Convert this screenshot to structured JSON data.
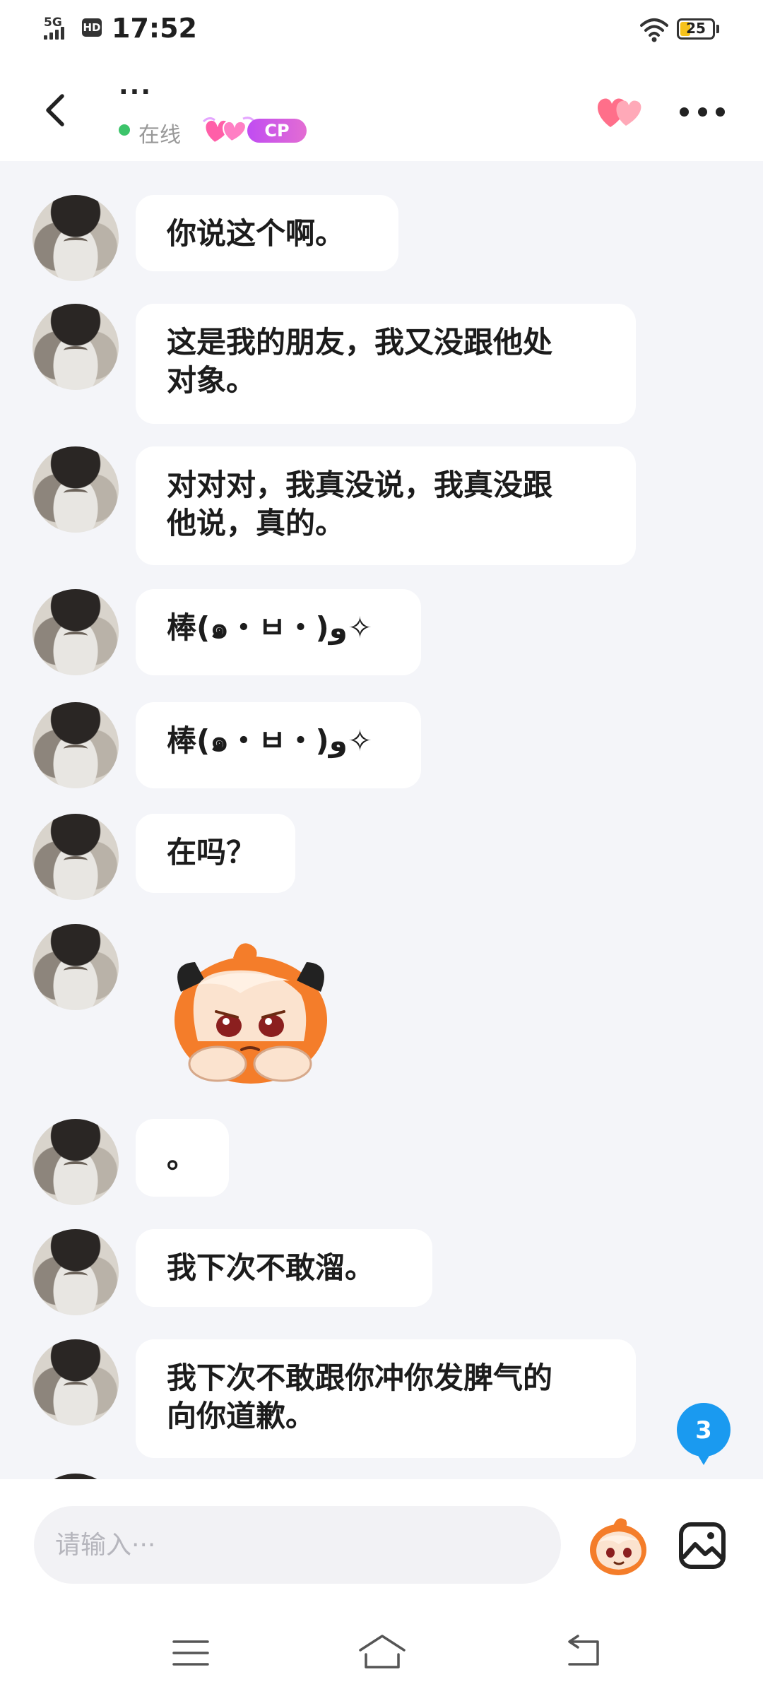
{
  "status_bar": {
    "network": "5G",
    "hd_label": "HD",
    "time": "17:52",
    "battery": "25"
  },
  "header": {
    "title": "···",
    "online_label": "在线",
    "badge_label": "CP"
  },
  "messages": [
    {
      "type": "text",
      "text": "你说这个啊。"
    },
    {
      "type": "text",
      "text": "这是我的朋友，我又没跟他处\n对象。"
    },
    {
      "type": "text",
      "text": "对对对，我真没说，我真没跟\n他说，真的。"
    },
    {
      "type": "text",
      "text": "棒(๑・ㅂ・)و✧"
    },
    {
      "type": "text",
      "text": "棒(๑・ㅂ・)و✧"
    },
    {
      "type": "text",
      "text": "在吗？"
    },
    {
      "type": "sticker",
      "sticker": "sad-orange-hair-girl-sticker"
    },
    {
      "type": "text",
      "text": "。"
    },
    {
      "type": "text",
      "text": "我下次不敢溜。"
    },
    {
      "type": "text",
      "text": "我下次不敢跟你冲你发脾气的\n向你道歉。"
    }
  ],
  "unread_count": "3",
  "composer": {
    "placeholder": "请输入···"
  },
  "colors": {
    "background": "#f4f5f9",
    "bubble": "#ffffff",
    "online": "#3cc46a",
    "unread_badge": "#1a9af0",
    "cp_badge": "#c04cf2"
  },
  "icons": [
    "back-icon",
    "heart-icon",
    "more-icon",
    "emoji-sticker-icon",
    "image-icon",
    "menu-icon",
    "home-icon",
    "return-icon"
  ]
}
